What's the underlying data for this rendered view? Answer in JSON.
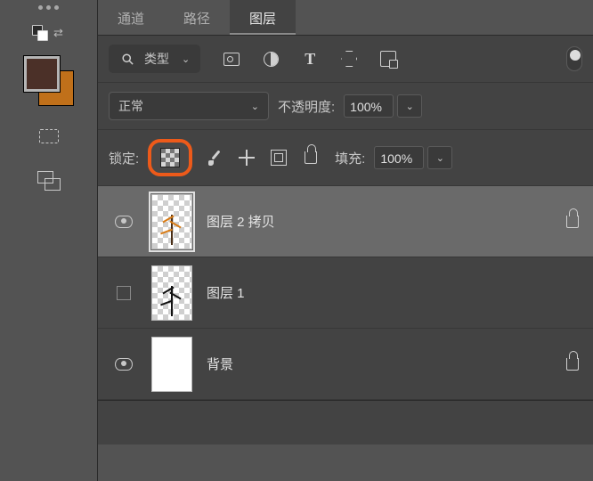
{
  "tabs": {
    "channels": "通道",
    "paths": "路径",
    "layers": "图层",
    "active": "layers"
  },
  "filter": {
    "label": "类型"
  },
  "blend": {
    "mode": "正常"
  },
  "opacity": {
    "label": "不透明度:",
    "value": "100%"
  },
  "fill": {
    "label": "填充:",
    "value": "100%"
  },
  "lock": {
    "label": "锁定:"
  },
  "layers": [
    {
      "name": "图层 2 拷贝",
      "visible": true,
      "selected": true,
      "locked": true,
      "thumb": "orange-tree"
    },
    {
      "name": "图层 1",
      "visible": false,
      "selected": false,
      "locked": false,
      "thumb": "black-tree"
    },
    {
      "name": "背景",
      "visible": true,
      "selected": false,
      "locked": true,
      "thumb": "white"
    }
  ],
  "colors": {
    "foreground": "#4b3028",
    "background": "#c0701a",
    "highlight": "#ed5a1a"
  }
}
